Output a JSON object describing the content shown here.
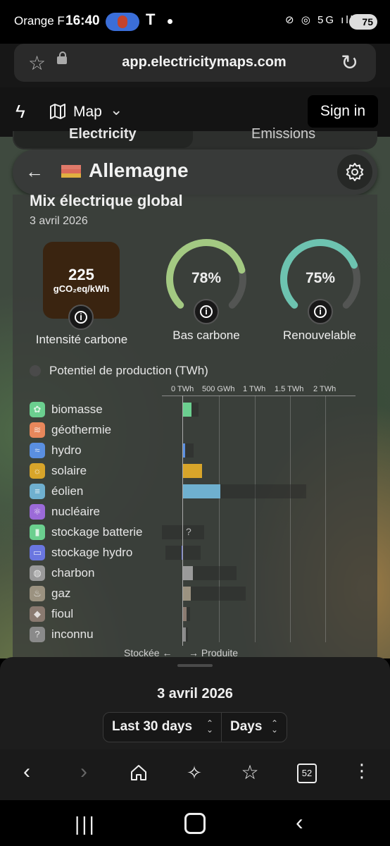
{
  "status_bar": {
    "carrier": "Orange F",
    "time": "16:40",
    "battery": "75",
    "tesla_glyph": "T",
    "icons": "⊘ ◎ 5G ıll"
  },
  "browser": {
    "url": "app.electricitymaps.com",
    "tab_count": "52"
  },
  "header": {
    "map_label": "Map",
    "signin_label": "Sign in"
  },
  "tabs": {
    "electricity": "Electricity",
    "emissions": "Emissions"
  },
  "zone": {
    "name": "Allemagne",
    "flag_colors": [
      "#e07a6a",
      "#d96a5a",
      "#e0b040"
    ]
  },
  "panel": {
    "title": "Mix électrique global",
    "date": "3 avril 2026",
    "carbon_intensity": {
      "value": "225",
      "unit": "gCO₂eq/kWh",
      "label": "Intensité carbone"
    },
    "low_carbon": {
      "value": "78%",
      "fraction": 0.78,
      "label": "Bas carbone",
      "color": "#a3c982"
    },
    "renewable": {
      "value": "75%",
      "fraction": 0.75,
      "label": "Renouvelable",
      "color": "#6dc3b0"
    }
  },
  "production": {
    "legend_label": "Potentiel de production (TWh)",
    "axis_ticks": [
      "0 TWh",
      "500 GWh",
      "1 TWh",
      "1.5 TWh",
      "2 TWh"
    ],
    "footer_stored": "Stockée ←",
    "footer_produced": "→ Produite",
    "unknown_marker": "?",
    "rows": [
      {
        "label": "biomasse",
        "color": "#6bcf8f",
        "icon_glyph": "✿",
        "value_twh": 0.12,
        "capacity_twh": 0.22
      },
      {
        "label": "géothermie",
        "color": "#e8875b",
        "icon_glyph": "≋",
        "value_twh": 0.0,
        "capacity_twh": 0.0
      },
      {
        "label": "hydro",
        "color": "#5a8fe0",
        "icon_glyph": "≈",
        "value_twh": 0.03,
        "capacity_twh": 0.15
      },
      {
        "label": "solaire",
        "color": "#d8a52a",
        "icon_glyph": "☼",
        "value_twh": 0.27,
        "capacity_twh": 0.27
      },
      {
        "label": "éolien",
        "color": "#6fb0cf",
        "icon_glyph": "≡",
        "value_twh": 0.53,
        "capacity_twh": 1.75
      },
      {
        "label": "nucléaire",
        "color": "#9b6ad8",
        "icon_glyph": "⚛",
        "value_twh": 0.0,
        "capacity_twh": 0.0
      },
      {
        "label": "stockage batterie",
        "color": "#6bcf8f",
        "icon_glyph": "▮",
        "value_twh": 0.0,
        "capacity_twh": 0.3,
        "stored_capacity_twh": 0.3
      },
      {
        "label": "stockage hydro",
        "color": "#6a76e0",
        "icon_glyph": "▭",
        "value_twh": -0.02,
        "capacity_twh": 0.25,
        "stored_capacity_twh": 0.25
      },
      {
        "label": "charbon",
        "color": "#9a9a9a",
        "icon_glyph": "◍",
        "value_twh": 0.14,
        "capacity_twh": 0.76
      },
      {
        "label": "gaz",
        "color": "#9b9280",
        "icon_glyph": "♨",
        "value_twh": 0.11,
        "capacity_twh": 0.89
      },
      {
        "label": "fioul",
        "color": "#8a7a70",
        "icon_glyph": "◆",
        "value_twh": 0.05,
        "capacity_twh": 0.1
      },
      {
        "label": "inconnu",
        "color": "#8a8a8a",
        "icon_glyph": "?",
        "value_twh": 0.04,
        "capacity_twh": 0.07
      }
    ]
  },
  "sheet": {
    "date": "3 avril 2026",
    "range_label": "Last 30 days",
    "granularity_label": "Days"
  }
}
